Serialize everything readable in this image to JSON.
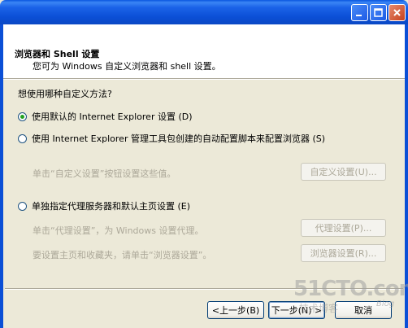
{
  "window": {
    "title": "",
    "controls": [
      "minimize-icon",
      "maximize-icon",
      "close-icon"
    ]
  },
  "header": {
    "title": "浏览器和 Shell 设置",
    "subtitle": "您可为 Windows 自定义浏览器和 shell 设置。"
  },
  "question": "想使用哪种自定义方法?",
  "options": [
    {
      "label": "使用默认的 Internet Explorer 设置 (D)",
      "checked": true
    },
    {
      "label": "使用 Internet Explorer 管理工具包创建的自动配置脚本来配置浏览器 (S)",
      "checked": false
    },
    {
      "label": "单独指定代理服务器和默认主页设置 (E)",
      "checked": false
    }
  ],
  "autoconfig": {
    "hint": "单击“自定义设置”按钮设置这些值。",
    "button": "自定义设置(U)..."
  },
  "proxy": {
    "hint": "单击“代理设置”，为 Windows 设置代理。",
    "button": "代理设置(P)..."
  },
  "homepage": {
    "hint": "要设置主页和收藏夹，请单击“浏览器设置”。",
    "button": "浏览器设置(R)..."
  },
  "footer": {
    "back": "<上一步(B)",
    "next": "下一步(N) >",
    "cancel": "取消"
  },
  "watermark": {
    "brand": "51CTO.com",
    "sub": "技术博客",
    "blog": "Blog"
  }
}
